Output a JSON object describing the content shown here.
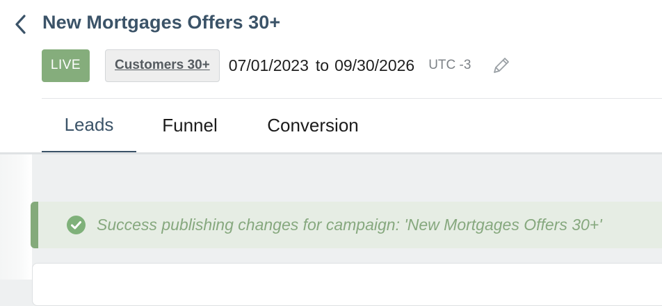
{
  "header": {
    "back_icon": "chevron-left-icon",
    "title": "New Mortgages Offers 30+",
    "status_badge": "LIVE",
    "segment": "Customers 30+",
    "date_start": "07/01/2023",
    "date_separator": "to",
    "date_end": "09/30/2026",
    "timezone": "UTC -3",
    "edit_icon": "pencil-icon"
  },
  "tabs": [
    {
      "label": "Leads",
      "active": true
    },
    {
      "label": "Funnel",
      "active": false
    },
    {
      "label": "Conversion",
      "active": false
    }
  ],
  "alert": {
    "icon": "check-circle-icon",
    "message": "Success publishing changes for campaign: 'New Mortgages Offers 30+'"
  },
  "colors": {
    "primary": "#3b5368",
    "success": "#85ad7c",
    "success_text": "#86a87e",
    "success_bg": "#e6ede4"
  }
}
